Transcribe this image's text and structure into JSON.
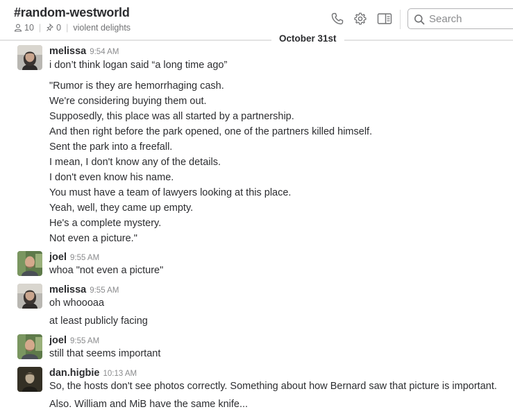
{
  "channel": {
    "name": "#random-westworld",
    "member_count": "10",
    "pin_count": "0",
    "topic": "violent delights"
  },
  "search": {
    "placeholder": "Search"
  },
  "date_divider": "October 31st",
  "messages": [
    {
      "author": "melissa",
      "time": "9:54 AM",
      "lines": [
        "i don’t think logan said “a long time ago”",
        "\"Rumor is they are hemorrhaging cash.",
        "We're considering buying them out.",
        "Supposedly, this place was all started by a partnership.",
        "And then right before the park opened, one of the partners killed himself.",
        "Sent the park into a freefall.",
        "I mean, I don't know any of the details.",
        "I don't even know his name.",
        "You must have a team of lawyers looking at this place.",
        "Yeah, well, they came up empty.",
        "He's a complete mystery.",
        "Not even a picture.\""
      ]
    },
    {
      "author": "joel",
      "time": "9:55 AM",
      "lines": [
        "whoa \"not even a picture\""
      ]
    },
    {
      "author": "melissa",
      "time": "9:55 AM",
      "lines": [
        "oh whoooaa",
        "at least publicly facing"
      ]
    },
    {
      "author": "joel",
      "time": "9:55 AM",
      "lines": [
        "still that seems important"
      ]
    },
    {
      "author": "dan.higbie",
      "time": "10:13 AM",
      "lines": [
        "So, the hosts don't see photos correctly. Something about how Bernard saw that picture is important.",
        "Also. William and MiB have the same knife..."
      ]
    }
  ]
}
